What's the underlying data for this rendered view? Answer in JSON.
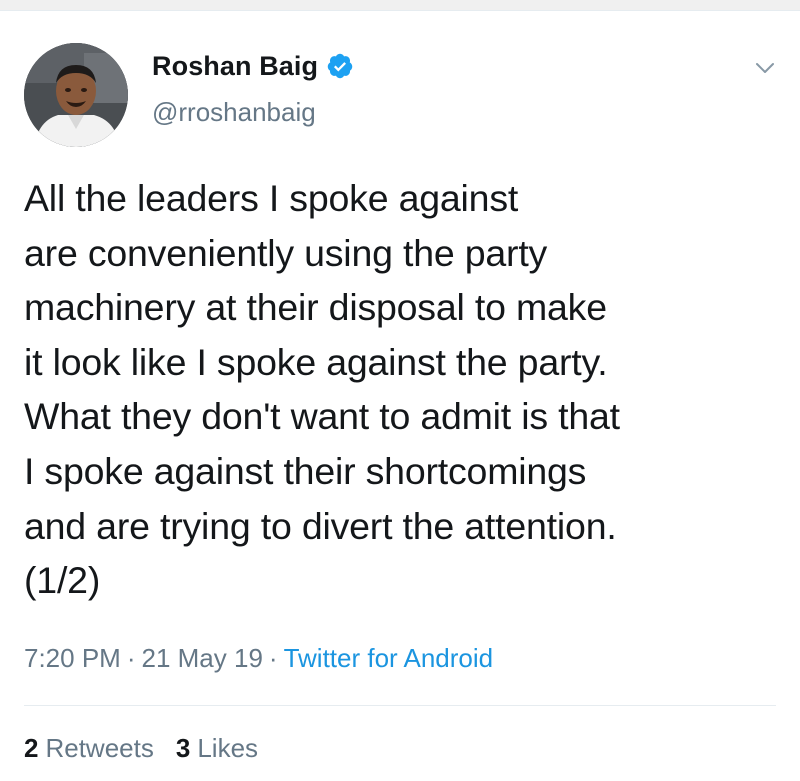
{
  "tweet": {
    "author": {
      "display_name": "Roshan Baig",
      "handle": "@rroshanbaig",
      "verified": true,
      "avatar_icon": "profile-photo-icon"
    },
    "text": "All the leaders I spoke against\nare conveniently using the party\nmachinery at their disposal to make\nit look like I spoke against the party.\nWhat they don't want to admit is that\nI spoke against their shortcomings\nand are trying to divert the attention.\n(1/2)",
    "meta": {
      "time": "7:20 PM",
      "separator": "·",
      "date": "21 May 19",
      "source": "Twitter for Android"
    },
    "stats": {
      "retweets_count": "2",
      "retweets_label": "Retweets",
      "likes_count": "3",
      "likes_label": "Likes"
    },
    "colors": {
      "text": "#14171a",
      "secondary": "#657786",
      "link": "#1b95e0",
      "verified_badge": "#1da1f2",
      "divider": "#e6ecf0"
    },
    "icons": {
      "verified": "verified-badge-icon",
      "more": "chevron-down-icon"
    }
  }
}
